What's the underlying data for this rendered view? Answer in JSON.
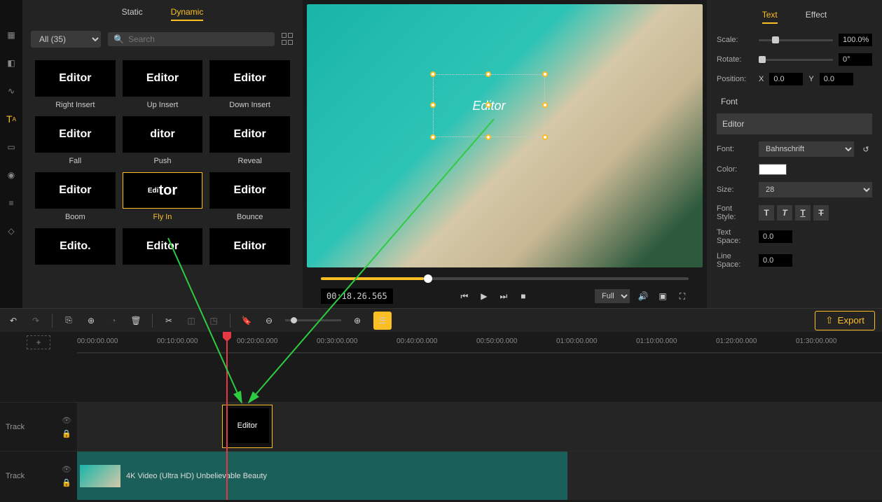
{
  "left_panel": {
    "tab_static": "Static",
    "tab_dynamic": "Dynamic",
    "category": "All (35)",
    "search_placeholder": "Search",
    "effects": [
      {
        "label": "Right Insert",
        "thumb": "Editor"
      },
      {
        "label": "Up Insert",
        "thumb": "Editor"
      },
      {
        "label": "Down Insert",
        "thumb": "Editor"
      },
      {
        "label": "Fall",
        "thumb": "Editor"
      },
      {
        "label": "Push",
        "thumb": "ditor"
      },
      {
        "label": "Reveal",
        "thumb": "Editor"
      },
      {
        "label": "Boom",
        "thumb": "Editor"
      },
      {
        "label": "Fly In",
        "thumb": "Editor",
        "selected": true,
        "thumbStyle": "flyin"
      },
      {
        "label": "Bounce",
        "thumb": "Editor"
      },
      {
        "label": "",
        "thumb": "Edito."
      },
      {
        "label": "",
        "thumb": "Editor"
      },
      {
        "label": "",
        "thumb": "Editor"
      }
    ]
  },
  "preview": {
    "overlay_text": "Editor",
    "timecode": "00:18.26.565",
    "view_mode": "Full"
  },
  "right_panel": {
    "tab_text": "Text",
    "tab_effect": "Effect",
    "scale_label": "Scale:",
    "scale_value": "100.0%",
    "rotate_label": "Rotate:",
    "rotate_value": "0°",
    "position_label": "Position:",
    "pos_x_label": "X",
    "pos_x": "0.0",
    "pos_y_label": "Y",
    "pos_y": "0.0",
    "font_section": "Font",
    "text_value": "Editor",
    "font_label": "Font:",
    "font_value": "Bahnschrift",
    "color_label": "Color:",
    "size_label": "Size:",
    "size_value": "28",
    "style_label": "Font Style:",
    "textspace_label": "Text Space:",
    "textspace_value": "0.0",
    "linespace_label": "Line Space:",
    "linespace_value": "0.0"
  },
  "toolbar": {
    "export": "Export"
  },
  "timeline": {
    "track_label": "Track",
    "ruler": [
      "00:00:00.000",
      "00:10:00.000",
      "00:20:00.000",
      "00:30:00.000",
      "00:40:00.000",
      "00:50:00.000",
      "01:00:00.000",
      "01:10:00.000",
      "01:20:00.000",
      "01:30:00.000"
    ],
    "text_clip_label": "Editor",
    "video_title": "4K Video (Ultra HD) Unbelievable Beauty"
  }
}
